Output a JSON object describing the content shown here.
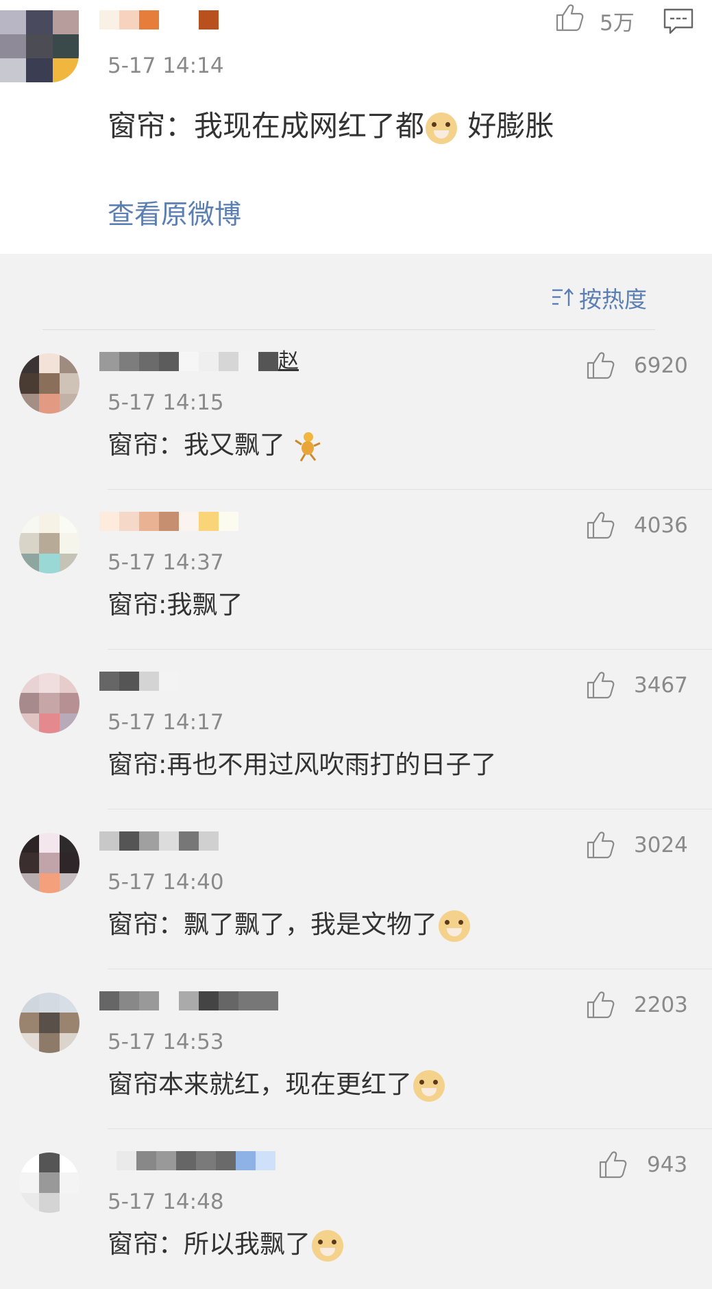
{
  "main_post": {
    "time": "5-17 14:14",
    "likes": "5万",
    "text_before": "窗帘：我现在成网红了都",
    "emoji": "doge-emoji",
    "text_after": " 好膨胀",
    "view_original": "查看原微博"
  },
  "sort_label": "按热度",
  "comments": [
    {
      "time": "5-17 14:15",
      "likes": "6920",
      "text": "窗帘：我又飘了",
      "emoji": "dancing-emoji",
      "name_suffix": "赵"
    },
    {
      "time": "5-17 14:37",
      "likes": "4036",
      "text": "窗帘:我飘了",
      "emoji": ""
    },
    {
      "time": "5-17 14:17",
      "likes": "3467",
      "text": "窗帘:再也不用过风吹雨打的日子了",
      "emoji": ""
    },
    {
      "time": "5-17 14:40",
      "likes": "3024",
      "text": "窗帘：飘了飘了，我是文物了",
      "emoji": "doge-emoji"
    },
    {
      "time": "5-17 14:53",
      "likes": "2203",
      "text": "窗帘本来就红，现在更红了",
      "emoji": "doge-emoji"
    },
    {
      "time": "5-17 14:48",
      "likes": "943",
      "text": "窗帘：所以我飘了",
      "emoji": "doge-emoji"
    }
  ],
  "icons": {
    "like": "thumbs-up-icon",
    "reply": "comment-bubble-icon",
    "sort": "sort-icon"
  }
}
